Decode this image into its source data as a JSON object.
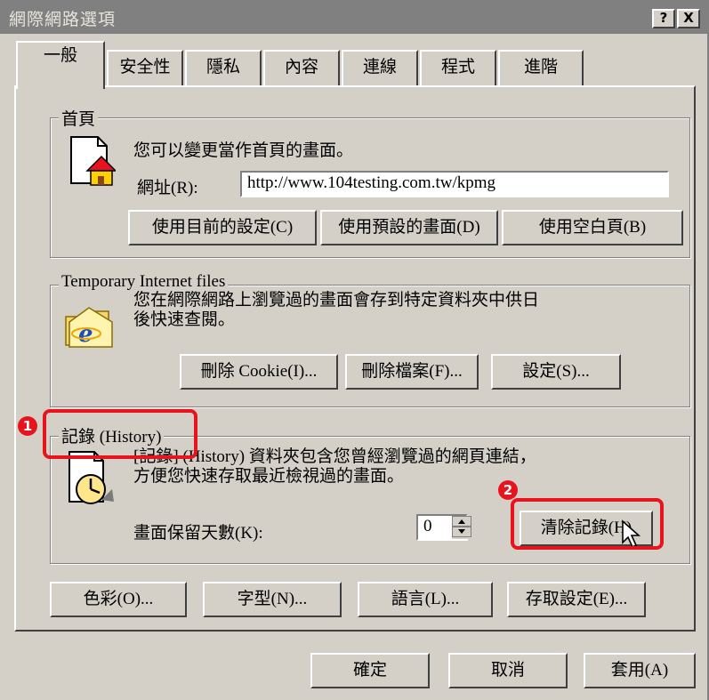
{
  "window": {
    "title": "網際網路選項",
    "help_label": "?",
    "close_label": "X"
  },
  "tabs": [
    "一般",
    "安全性",
    "隱私",
    "內容",
    "連線",
    "程式",
    "進階"
  ],
  "home": {
    "group_label": "首頁",
    "description": "您可以變更當作首頁的畫面。",
    "address_label": "網址(R):",
    "address_value": "http://www.104testing.com.tw/kpmg",
    "buttons": [
      "使用目前的設定(C)",
      "使用預設的畫面(D)",
      "使用空白頁(B)"
    ]
  },
  "temp_files": {
    "group_label": "Temporary Internet files",
    "description_line1": "您在網際網路上瀏覽過的畫面會存到特定資料夾中供日",
    "description_line2": "後快速查閱。",
    "buttons": [
      "刪除 Cookie(I)...",
      "刪除檔案(F)...",
      "設定(S)..."
    ]
  },
  "history": {
    "group_label": "記錄 (History)",
    "description_line1": "[記錄] (History) 資料夾包含您曾經瀏覽過的網頁連結，",
    "description_line2": "方便您快速存取最近檢視過的畫面。",
    "days_label": "畫面保留天數(K):",
    "days_value": "0",
    "clear_button": "清除記錄(H)"
  },
  "bottom_row": [
    "色彩(O)...",
    "字型(N)...",
    "語言(L)...",
    "存取設定(E)..."
  ],
  "dialog_buttons": {
    "ok": "確定",
    "cancel": "取消",
    "apply": "套用(A)"
  },
  "annotations": {
    "marker1": "1",
    "marker2": "2",
    "color": "#e8141d"
  }
}
